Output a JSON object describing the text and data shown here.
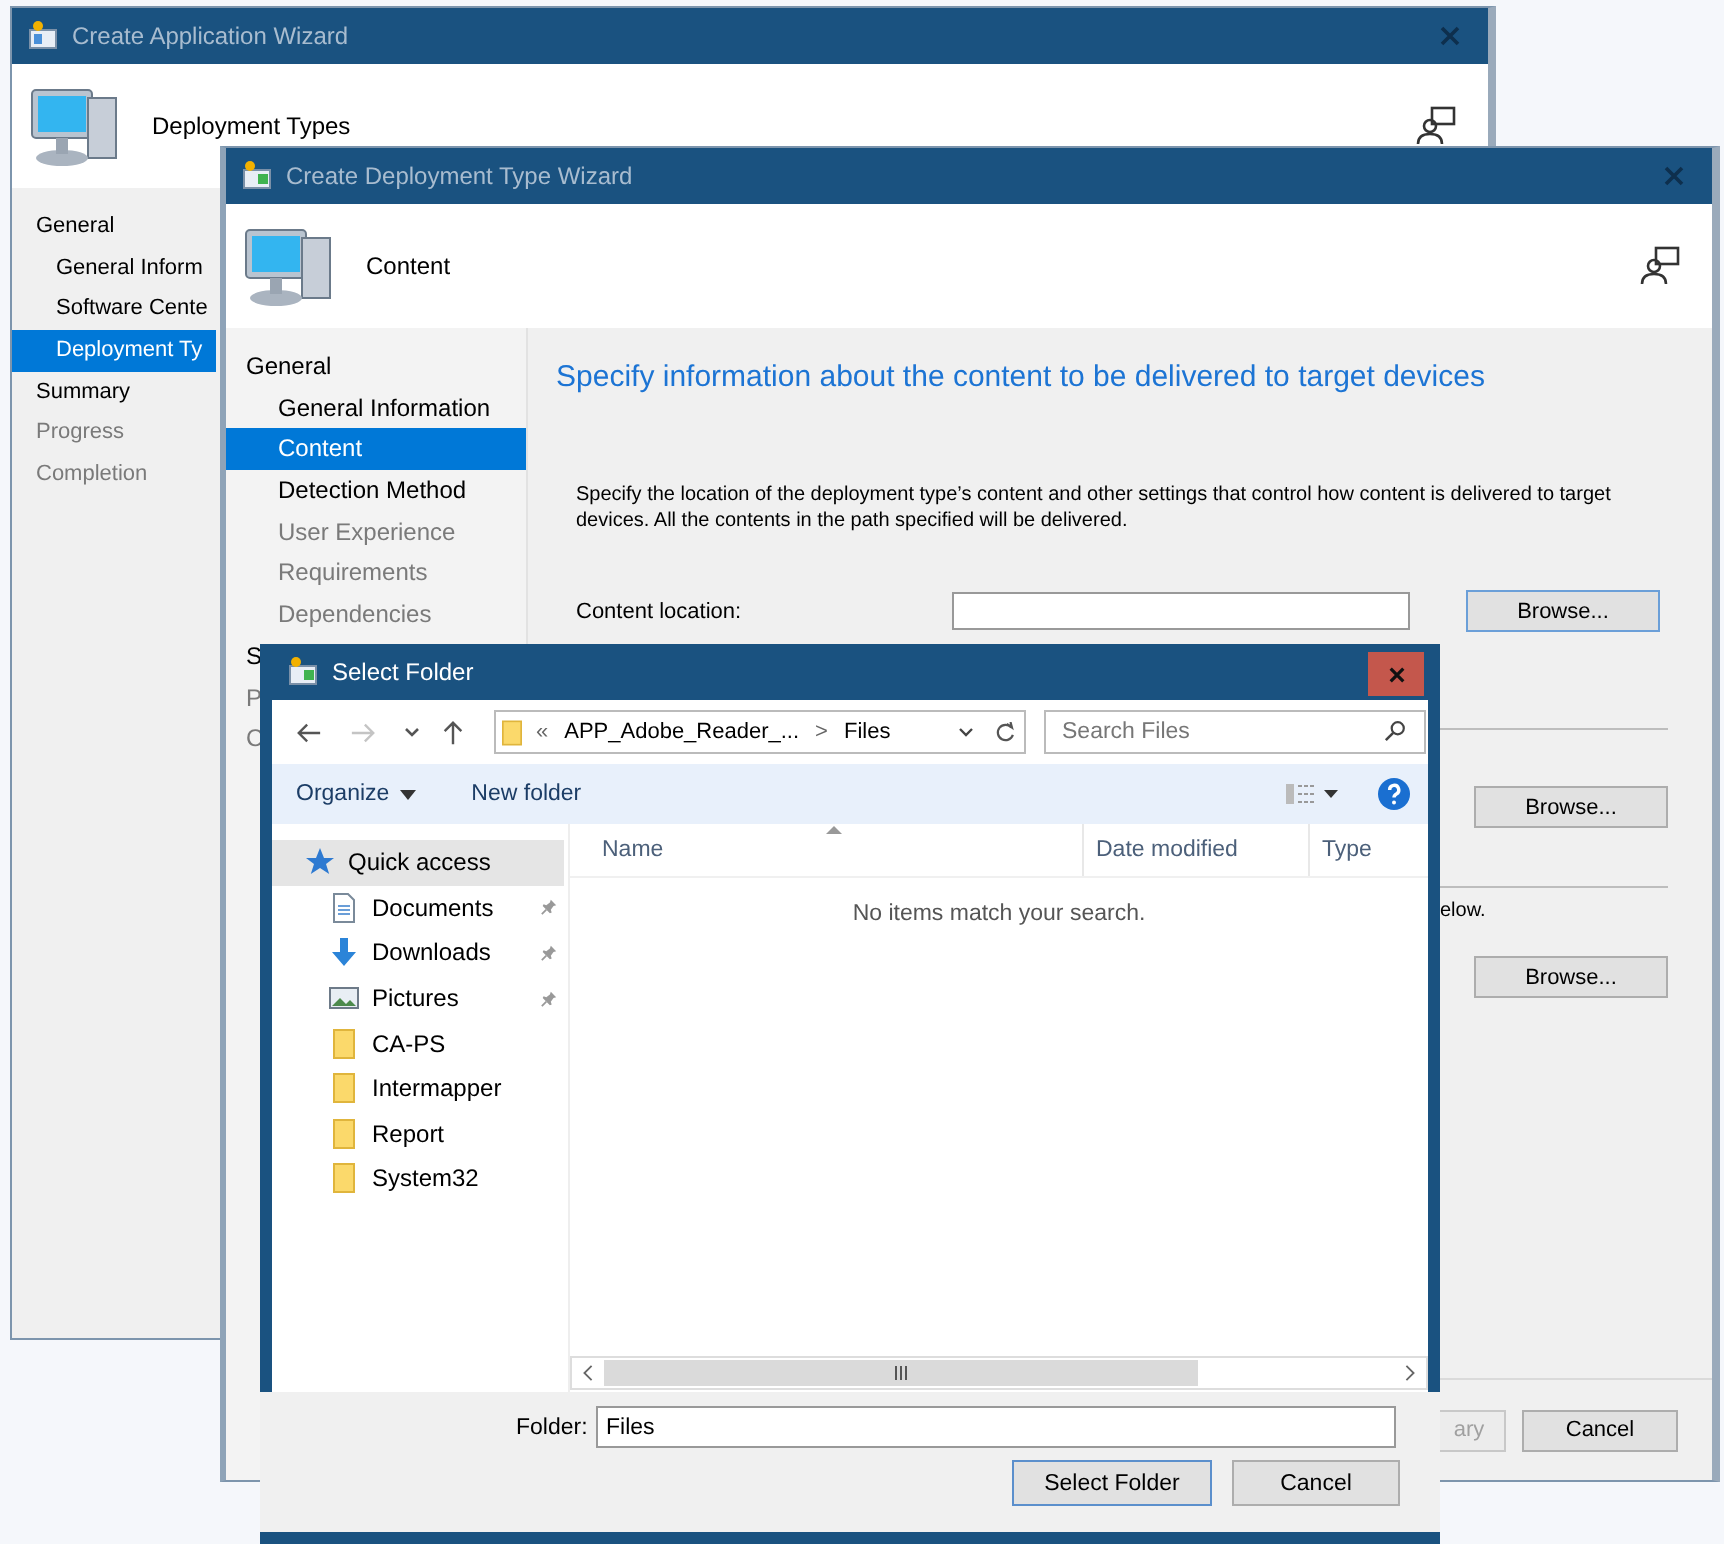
{
  "back_window": {
    "title": "Create Application Wizard",
    "header": "Deployment Types",
    "nav": [
      {
        "label": "General",
        "selected": false,
        "disabled": false,
        "children": [
          {
            "label": "General Inform",
            "selected": false,
            "disabled": false
          },
          {
            "label": "Software Cente",
            "selected": false,
            "disabled": false
          },
          {
            "label": "Deployment Ty",
            "selected": true,
            "disabled": false
          }
        ]
      },
      {
        "label": "Summary",
        "selected": false,
        "disabled": false
      },
      {
        "label": "Progress",
        "selected": false,
        "disabled": true
      },
      {
        "label": "Completion",
        "selected": false,
        "disabled": true
      }
    ]
  },
  "middle_window": {
    "title": "Create Deployment Type Wizard",
    "header": "Content",
    "nav": [
      {
        "label": "General",
        "selected": false,
        "disabled": false,
        "children": [
          {
            "label": "General Information",
            "selected": false,
            "disabled": false
          },
          {
            "label": "Content",
            "selected": true,
            "disabled": false
          },
          {
            "label": "Detection Method",
            "selected": false,
            "disabled": false
          },
          {
            "label": "User Experience",
            "selected": false,
            "disabled": true
          },
          {
            "label": "Requirements",
            "selected": false,
            "disabled": true
          },
          {
            "label": "Dependencies",
            "selected": false,
            "disabled": true
          }
        ]
      },
      {
        "label": "S",
        "selected": false,
        "disabled": false
      },
      {
        "label": "P",
        "selected": false,
        "disabled": true
      },
      {
        "label": "C",
        "selected": false,
        "disabled": true
      }
    ],
    "heading": "Specify information about the content to be delivered to target devices",
    "description": "Specify the location of the deployment type’s content and other settings that control how content is delivered to target devices. All the contents in the path specified will be delivered.",
    "content_location_label": "Content location:",
    "browse_buttons": [
      "Browse...",
      "Browse...",
      "Browse..."
    ],
    "partial_text": "elow.",
    "footer_buttons": [
      {
        "label": "ary",
        "disabled": true
      },
      {
        "label": "Cancel",
        "disabled": false
      }
    ]
  },
  "dialog": {
    "title": "Select Folder",
    "address": {
      "overflow": "«",
      "segments": [
        "APP_Adobe_Reader_...",
        "Files"
      ],
      "separator": ">"
    },
    "search": {
      "placeholder": "Search Files"
    },
    "toolbar": [
      {
        "label": "Organize",
        "dropdown": true
      },
      {
        "label": "New folder",
        "dropdown": false
      }
    ],
    "nav": [
      {
        "label": "Quick access",
        "kind": "star",
        "selected": true,
        "pinned": false,
        "children": [
          {
            "label": "Documents",
            "kind": "documents",
            "selected": false,
            "pinned": true
          },
          {
            "label": "Downloads",
            "kind": "downloads",
            "selected": false,
            "pinned": true
          },
          {
            "label": "Pictures",
            "kind": "pictures",
            "selected": false,
            "pinned": true
          },
          {
            "label": "CA-PS",
            "kind": "folder",
            "selected": false,
            "pinned": false
          },
          {
            "label": "Intermapper",
            "kind": "folder",
            "selected": false,
            "pinned": false
          },
          {
            "label": "Report",
            "kind": "folder",
            "selected": false,
            "pinned": false
          },
          {
            "label": "System32",
            "kind": "folder",
            "selected": false,
            "pinned": false
          }
        ]
      }
    ],
    "columns": [
      {
        "label": "Name",
        "sorted": true
      },
      {
        "label": "Date modified",
        "sorted": false
      },
      {
        "label": "Type",
        "sorted": false
      }
    ],
    "empty_message": "No items match your search.",
    "folder_label": "Folder:",
    "folder_value": "Files",
    "buttons": [
      {
        "label": "Select Folder",
        "default": true
      },
      {
        "label": "Cancel",
        "default": false
      }
    ]
  }
}
